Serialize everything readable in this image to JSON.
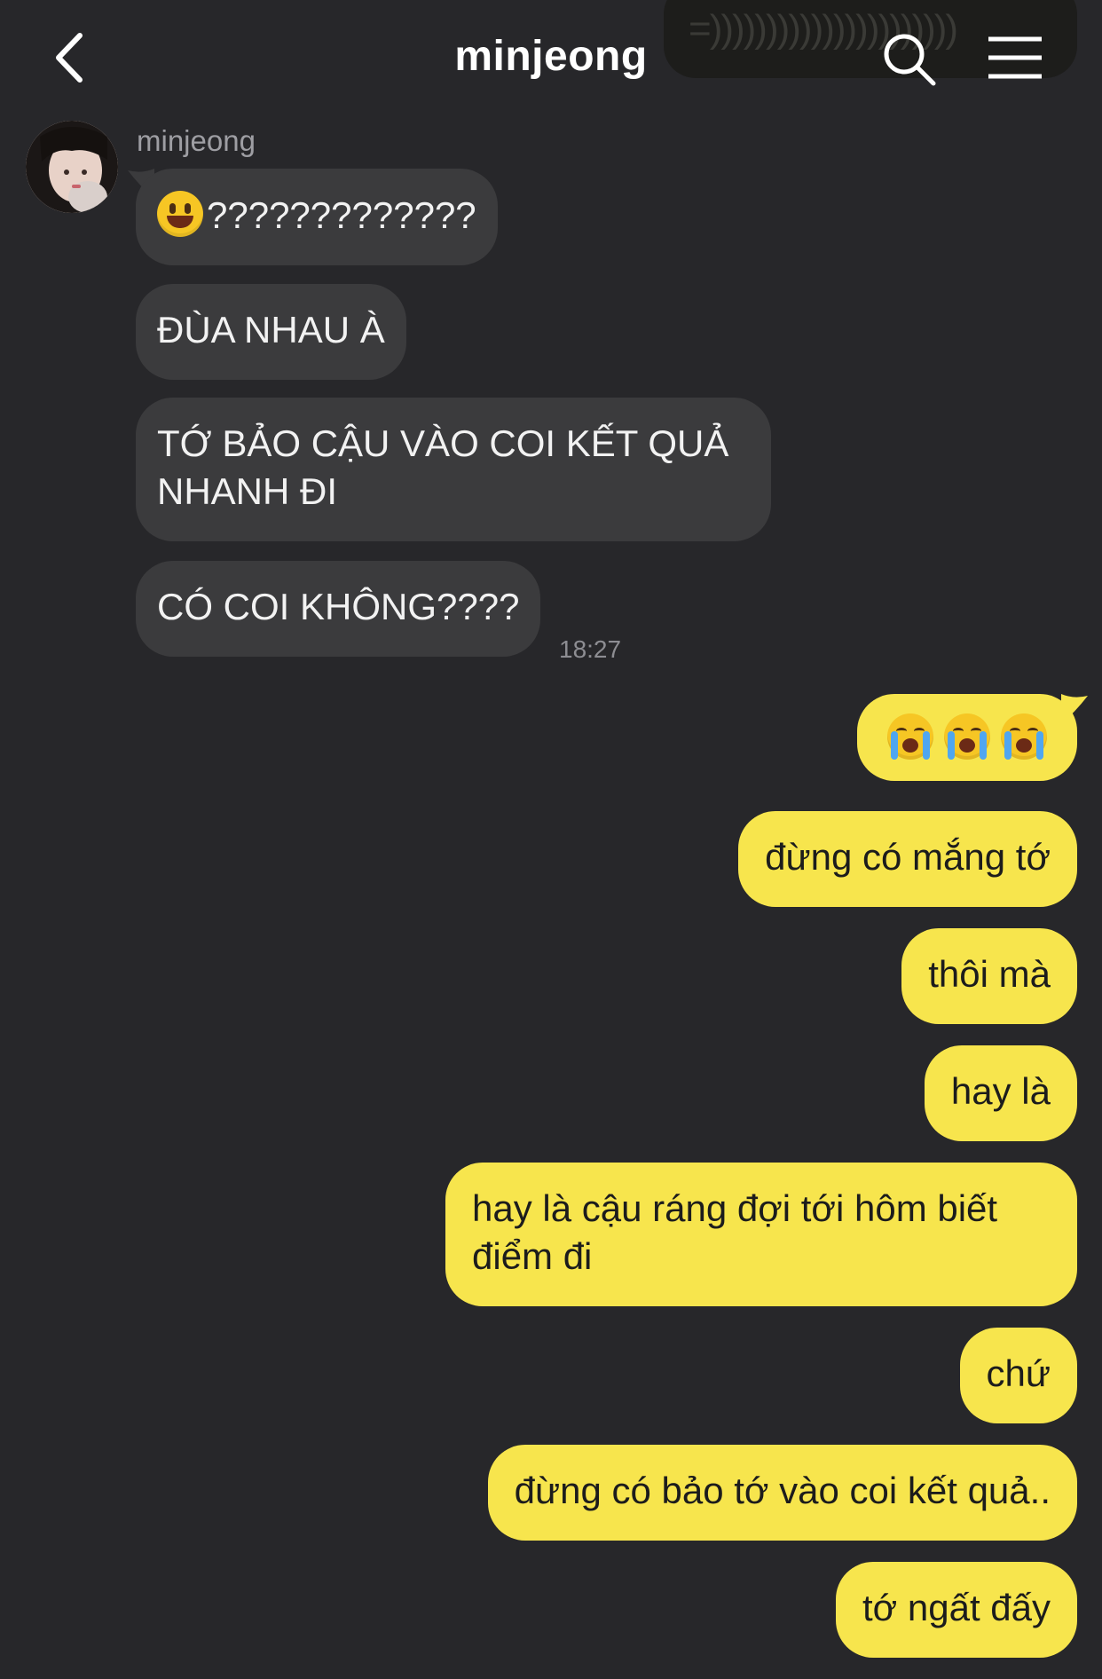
{
  "header": {
    "title": "minjeong",
    "ghost_text": "=))))))))))))))))))))))"
  },
  "sender": {
    "name": "minjeong"
  },
  "incoming": [
    {
      "text": "?????????????",
      "emoji": "grinning-face"
    },
    {
      "text": "ĐÙA NHAU À"
    },
    {
      "text": "TỚ BẢO CẬU VÀO COI KẾT QUẢ NHANH ĐI"
    },
    {
      "text": "CÓ COI KHÔNG????"
    }
  ],
  "incoming_time": "18:27",
  "outgoing": [
    {
      "emoji": "crying-face x3"
    },
    {
      "text": "đừng có mắng tớ"
    },
    {
      "text": "thôi mà"
    },
    {
      "text": "hay là"
    },
    {
      "text": "hay là cậu ráng đợi tới hôm biết điểm đi"
    },
    {
      "text": "chứ"
    },
    {
      "text": "đừng có bảo tớ vào coi kết quả.."
    },
    {
      "text": "tớ ngất đấy"
    }
  ],
  "colors": {
    "background": "#27272a",
    "incoming_bubble": "#3b3b3d",
    "outgoing_bubble": "#f7e54d"
  }
}
